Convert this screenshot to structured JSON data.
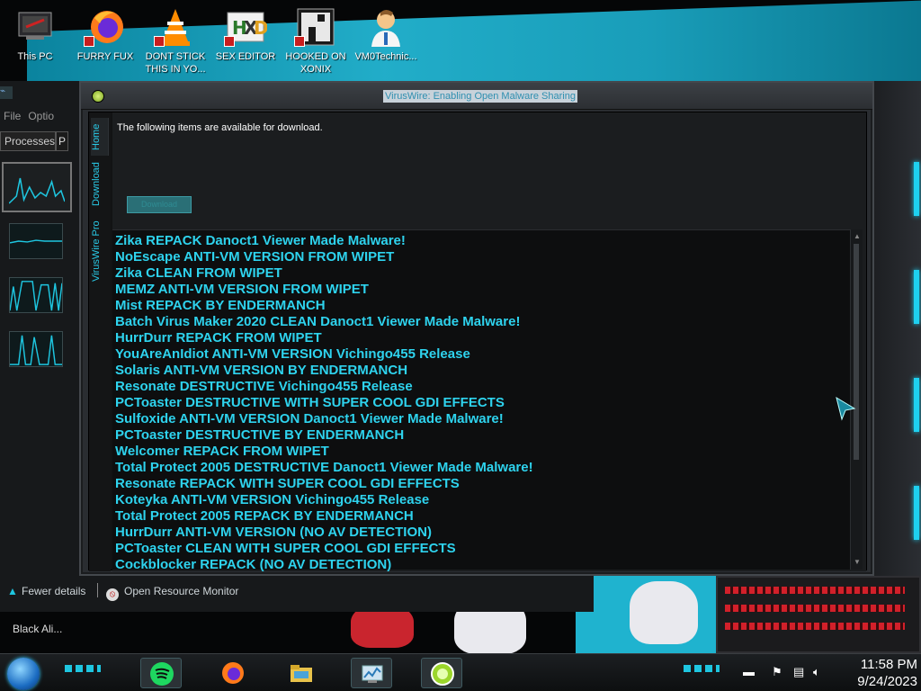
{
  "desktop": {
    "icons": [
      {
        "label": "This PC",
        "icon": "this-pc-icon"
      },
      {
        "label": "FURRY FUX",
        "icon": "firefox-icon"
      },
      {
        "label": "DONT STICK THIS IN YO...",
        "icon": "vlc-icon"
      },
      {
        "label": "SEX EDITOR",
        "icon": "hxd-editor-icon"
      },
      {
        "label": "HOOKED ON XONIX",
        "icon": "xonix-game-icon"
      },
      {
        "label": "VM0Technic...",
        "icon": "technician-icon"
      }
    ]
  },
  "task_manager": {
    "menu": [
      "File",
      "Optio"
    ],
    "tab_label": "Processes",
    "tab2_label": "P",
    "fewer_details": "Fewer details",
    "open_resource_monitor": "Open Resource Monitor"
  },
  "taskbar_label_above": "Black Ali...",
  "window": {
    "title": "VirusWire: Enabling Open Malware Sharing",
    "tabs": [
      "Home",
      "Download",
      "VirusWire Pro"
    ],
    "intro": "The following items are available for download.",
    "download_button": "Download",
    "items": [
      "Zika REPACK Danoct1 Viewer Made Malware!",
      "NoEscape ANTI-VM VERSION FROM WIPET",
      "Zika CLEAN FROM WIPET",
      "MEMZ ANTI-VM VERSION FROM WIPET",
      "Mist REPACK BY ENDERMANCH",
      "Batch Virus Maker 2020 CLEAN Danoct1 Viewer Made Malware!",
      "HurrDurr REPACK FROM WIPET",
      "YouAreAnIdiot ANTI-VM VERSION Vichingo455 Release",
      "Solaris ANTI-VM VERSION BY ENDERMANCH",
      "Resonate DESTRUCTIVE Vichingo455 Release",
      "PCToaster DESTRUCTIVE WITH SUPER COOL GDI EFFECTS",
      "Sulfoxide ANTI-VM VERSION Danoct1 Viewer Made Malware!",
      "PCToaster DESTRUCTIVE BY ENDERMANCH",
      "Welcomer REPACK FROM WIPET",
      "Total Protect 2005 DESTRUCTIVE Danoct1 Viewer Made Malware!",
      "Resonate REPACK WITH SUPER COOL GDI EFFECTS",
      "Koteyka ANTI-VM VERSION Vichingo455 Release",
      "Total Protect 2005 REPACK BY ENDERMANCH",
      "HurrDurr ANTI-VM VERSION (NO AV DETECTION)",
      "PCToaster CLEAN WITH SUPER COOL GDI EFFECTS",
      "Cockblocker REPACK (NO AV DETECTION)"
    ]
  },
  "taskbar": {
    "apps": [
      {
        "name": "spotify-icon",
        "active": true
      },
      {
        "name": "firefox-icon",
        "active": false
      },
      {
        "name": "file-explorer-icon",
        "active": false
      },
      {
        "name": "task-manager-icon",
        "active": true
      },
      {
        "name": "viruswire-icon",
        "active": true
      }
    ],
    "time": "11:58 PM",
    "date": "9/24/2023"
  },
  "colors": {
    "accent": "#2ed3ee",
    "window_bg": "#1b1d1f",
    "list_bg": "#0d0e0f"
  }
}
